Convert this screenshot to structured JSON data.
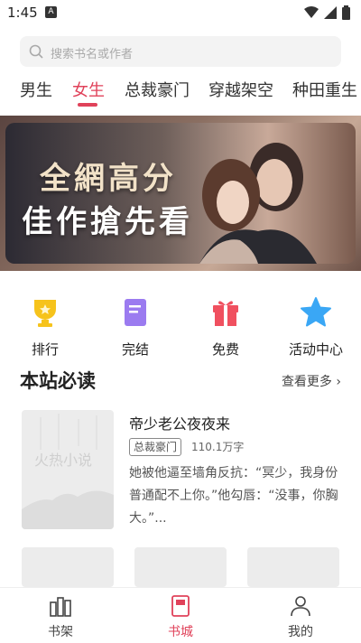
{
  "status": {
    "time": "1:45",
    "notif": "A"
  },
  "search": {
    "placeholder": "搜索书名或作者"
  },
  "tabs": [
    {
      "label": "男生"
    },
    {
      "label": "女生"
    },
    {
      "label": "总裁豪门"
    },
    {
      "label": "穿越架空"
    },
    {
      "label": "种田重生"
    }
  ],
  "banner": {
    "line1": "全網高分",
    "line2": "佳作搶先看"
  },
  "quick_links": [
    {
      "label": "排行",
      "icon": "trophy-icon",
      "color": "#f6c31c"
    },
    {
      "label": "完结",
      "icon": "book-icon",
      "color": "#9b7bf0"
    },
    {
      "label": "免费",
      "icon": "gift-icon",
      "color": "#f0505f"
    },
    {
      "label": "活动中心",
      "icon": "star-icon",
      "color": "#3aa7f5"
    }
  ],
  "section": {
    "title": "本站必读",
    "more": "查看更多 ›"
  },
  "book": {
    "title": "帝少老公夜夜来",
    "tag": "总裁豪门",
    "words": "110.1万字",
    "desc": "她被他逼至墙角反抗：“冥少，我身份普通配不上你。”他勾唇：“没事，你胸大。”..."
  },
  "placeholder_cover_text": "火热小说",
  "bottom_nav": [
    {
      "label": "书架"
    },
    {
      "label": "书城"
    },
    {
      "label": "我的"
    }
  ],
  "colors": {
    "accent": "#e0425a"
  }
}
